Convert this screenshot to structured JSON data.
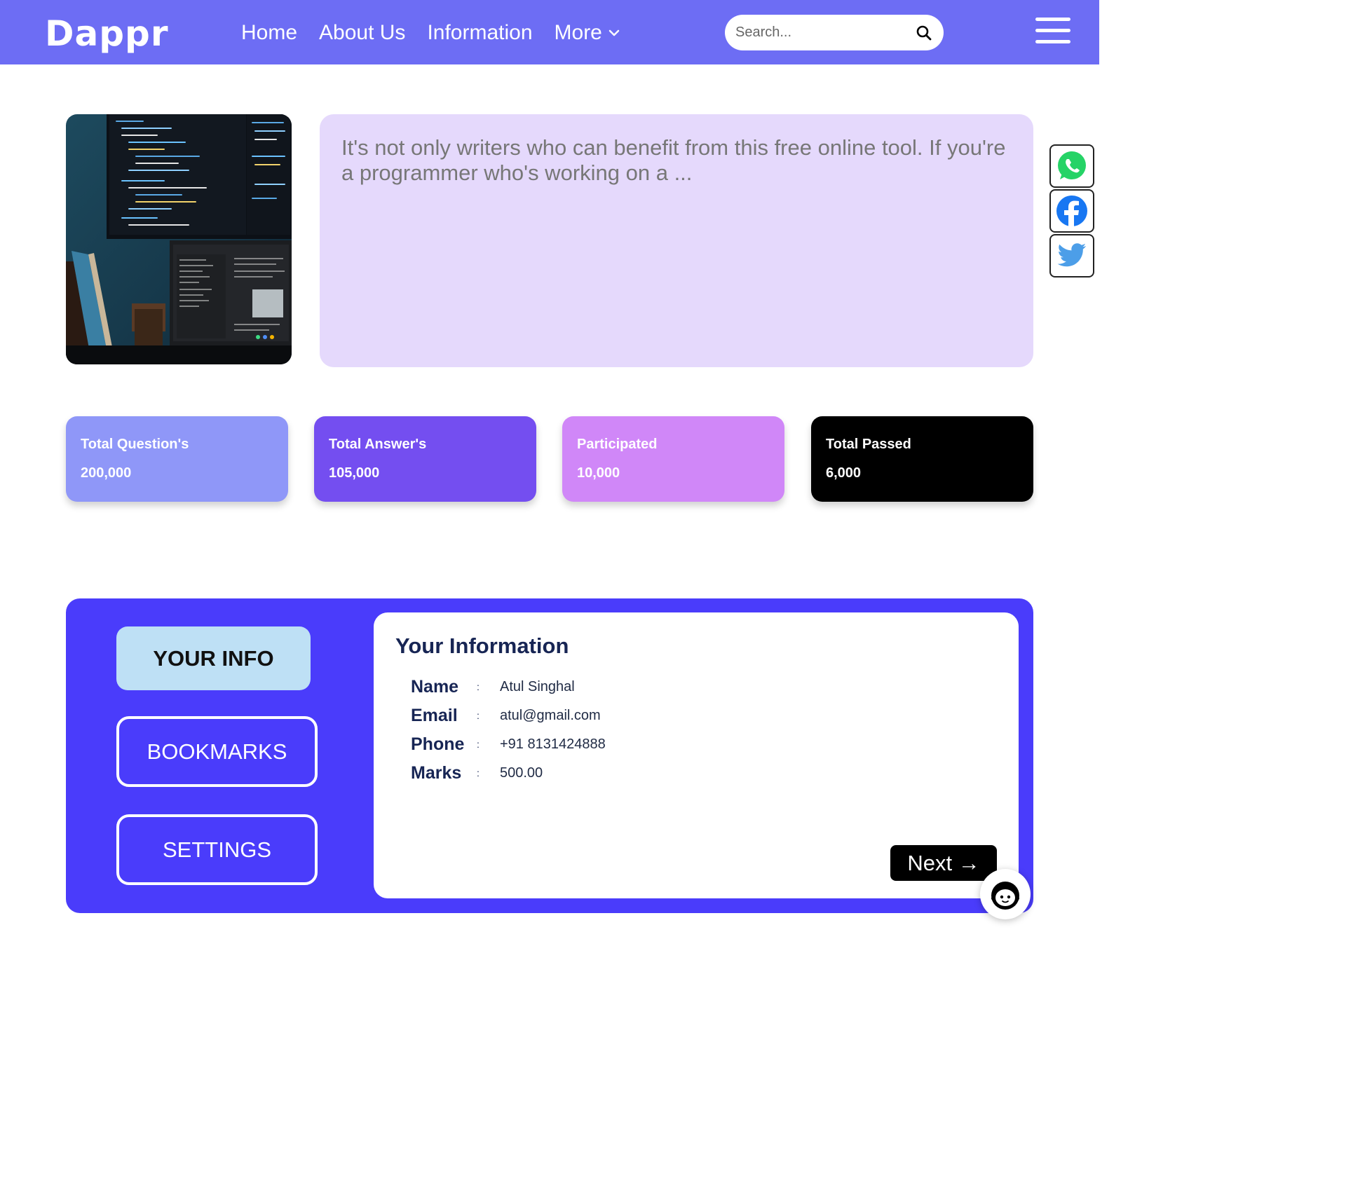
{
  "brand": {
    "logo_text": "Dappr"
  },
  "nav": {
    "links": [
      "Home",
      "About Us",
      "Information"
    ],
    "more_label": "More"
  },
  "search": {
    "placeholder": "Search..."
  },
  "hero": {
    "text": "It's not only writers who can benefit from this free online tool. If you're a programmer who's working on a ..."
  },
  "share": {
    "icons": [
      "whatsapp-icon",
      "facebook-icon",
      "twitter-icon"
    ]
  },
  "stats": [
    {
      "label": "Total Question's",
      "value": "200,000",
      "color": "#8f97f8"
    },
    {
      "label": "Total Answer's",
      "value": "105,000",
      "color": "#744ef0"
    },
    {
      "label": "Participated",
      "value": "10,000",
      "color": "#d087f8"
    },
    {
      "label": "Total Passed",
      "value": "6,000",
      "color": "#000000"
    }
  ],
  "sidebar": {
    "your_info": "YOUR INFO",
    "bookmarks": "BOOKMARKS",
    "settings": "SETTINGS"
  },
  "info": {
    "title": "Your Information",
    "rows": [
      {
        "key": "Name",
        "sep": ":",
        "value": "Atul Singhal"
      },
      {
        "key": "Email",
        "sep": ":",
        "value": "atul@gmail.com"
      },
      {
        "key": "Phone",
        "sep": ":",
        "value": "+91 8131424888"
      },
      {
        "key": "Marks",
        "sep": ":",
        "value": "500.00"
      }
    ],
    "next_label": "Next →"
  },
  "colors": {
    "navbar": "#6d6df4",
    "panel": "#4a3cfb",
    "hero_card": "#e5d9fc",
    "active_tab": "#bee0f5"
  }
}
